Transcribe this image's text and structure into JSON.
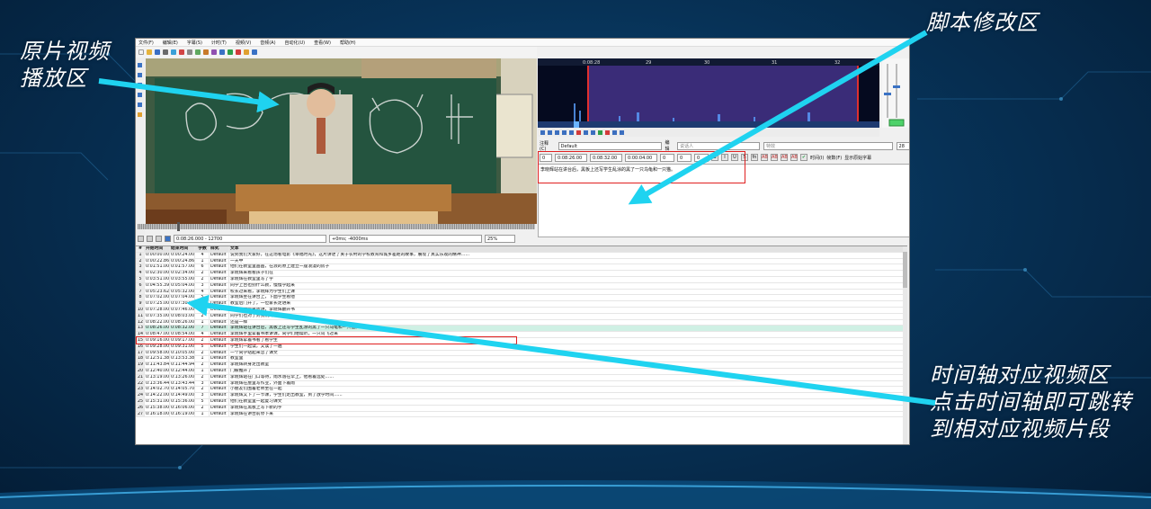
{
  "callouts": {
    "video_area": [
      "原片视频",
      "播放区"
    ],
    "script_area": "脚本修改区",
    "timeline_area": [
      "时间轴对应视频区",
      "点击时间轴即可跳转",
      "到相对应视频片段"
    ]
  },
  "menu": [
    "文件(F)",
    "编辑(E)",
    "字幕(S)",
    "计时(T)",
    "视频(V)",
    "音频(A)",
    "自动化(U)",
    "查看(W)",
    "帮助(H)"
  ],
  "video": {
    "time_display": "0:08:26.000 - 12700",
    "offset_display": "+0ms; -4000ms",
    "zoom": "25%"
  },
  "editor": {
    "comment_label": "注释(C)",
    "style": "Default",
    "actor_label": "编辑",
    "actor_placeholder": "说话人",
    "effect_placeholder": "特效",
    "layer": "28",
    "layer_value": "0",
    "start_time": "0:08:26.00",
    "end_time": "0:08:32.00",
    "duration": "0:00:04.00",
    "margin_l": "0",
    "margin_r": "0",
    "margin_v": "0",
    "format_buttons": [
      "B",
      "I",
      "U",
      "S",
      "fn",
      "AB",
      "AB",
      "AB",
      "AB"
    ],
    "radio_time": "时间(I)",
    "radio_frame": "帧数(F)",
    "show_original": "显示原始字幕",
    "text": "李晓辉站在讲台后，黑板上还写学生乱涂的黑了一只乌龟和一只猫。"
  },
  "wave": {
    "ticks": [
      "0:08:28",
      "29",
      "30",
      "31",
      "32"
    ]
  },
  "grid": {
    "headers": [
      "#",
      "开始时间",
      "结束时间",
      "字数",
      "样式",
      "文本"
    ],
    "rows": [
      [
        "1",
        "0:00:00.00",
        "0:00:24.00",
        "4",
        "Default",
        "说到我们大家好，在这场看电影《幸福时光》，这片讲述了关于农村的学校教育和城乡差距的故事，展现了真实乐观的精神……"
      ],
      [
        "2",
        "0:00:22.86",
        "0:00:24.86",
        "1",
        "Default",
        "一天中"
      ],
      [
        "3",
        "0:01:51.00",
        "0:01:57.00",
        "6",
        "Default",
        "他们在教室里画画，在浪的原上建立一座浪漫的房子"
      ],
      [
        "4",
        "0:02:30.00",
        "0:02:34.00",
        "2",
        "Default",
        "李晓辉来看看孩子们在"
      ],
      [
        "5",
        "0:03:51.00",
        "0:03:55.00",
        "2",
        "Default",
        "李晓辉在教室里写了字"
      ],
      [
        "6",
        "0:04:55.39",
        "0:05:04.00",
        "3",
        "Default",
        "同学上台也别什么教，慢慢学起来"
      ],
      [
        "7",
        "0:05:23.62",
        "0:05:32.00",
        "4",
        "Default",
        "校长过来看，李晓辉为学生们上课"
      ],
      [
        "8",
        "0:07:02.00",
        "0:07:04.00",
        "5",
        "Default",
        "李晓辉坐在讲台上，下面学生看他"
      ],
      [
        "9",
        "0:07:25.00",
        "0:07:30.00",
        "4",
        "Default",
        "教室后门开了，一位家长走进来"
      ],
      [
        "10",
        "0:07:28.00",
        "0:07:46.00",
        "5",
        "Default",
        "他们在教室里听讲，李晓辉翻开书"
      ],
      [
        "11",
        "0:07:35.00",
        "0:08:03.00",
        "2",
        "Default",
        "同学们也对了对我们的字"
      ],
      [
        "12",
        "0:08:22.00",
        "0:08:26.00",
        "1",
        "Default",
        "还是一样"
      ],
      [
        "13",
        "0:08:26.00",
        "0:08:32.00",
        "7",
        "Default",
        "李晓辉站在讲台后，黑板上还写学生乱涂的黑了一只乌龟和一只猫。"
      ],
      [
        "14",
        "0:08:47.00",
        "0:08:54.00",
        "4",
        "Default",
        "李晓辉手里拿着书本讲课，同学们继续听，一只鸟飞过来"
      ],
      [
        "15",
        "0:09:16.00",
        "0:09:17.00",
        "2",
        "Default",
        "李晓辉拿着书看了看学生"
      ],
      [
        "16",
        "0:09:28.00",
        "0:09:31.00",
        "5",
        "Default",
        "学生们一起读，又读了一遍"
      ],
      [
        "17",
        "0:09:58.00",
        "0:10:05.00",
        "2",
        "Default",
        "一个同学站起来念了课文"
      ],
      [
        "18",
        "0:12:51.38",
        "0:13:53.38",
        "1",
        "Default",
        "教室里"
      ],
      [
        "19",
        "0:11:43.84",
        "0:11:44.94",
        "2",
        "Default",
        "李晓辉转身走出教室"
      ],
      [
        "20",
        "0:12:40.00",
        "0:12:44.00",
        "1",
        "Default",
        "门被推开了"
      ],
      [
        "21",
        "0:13:19.00",
        "0:13:26.00",
        "2",
        "Default",
        "李晓辉站在门口等待，雨水落在伞上，他看着远处……"
      ],
      [
        "22",
        "0:13:36.44",
        "0:13:43.44",
        "3",
        "Default",
        "李晓辉在屋里写作业，外面下着雨"
      ],
      [
        "23",
        "0:14:02.70",
        "0:14:05.70",
        "2",
        "Default",
        "小朋友们围着老师坐在一起"
      ],
      [
        "24",
        "0:14:22.00",
        "0:14:49.00",
        "3",
        "Default",
        "李晓辉又下了一节课，学生们走出教室，到了放学时间……"
      ],
      [
        "25",
        "0:15:31.00",
        "0:15:36.00",
        "5",
        "Default",
        "他们在教室里一起复习课文"
      ],
      [
        "26",
        "0:15:38.00",
        "0:16:06.00",
        "2",
        "Default",
        "李晓辉在黑板上写下新的字"
      ],
      [
        "27",
        "0:16:18.00",
        "0:16:19.00",
        "1",
        "Default",
        "李晓辉在讲台前停下来"
      ]
    ],
    "highlight_index": 12
  }
}
